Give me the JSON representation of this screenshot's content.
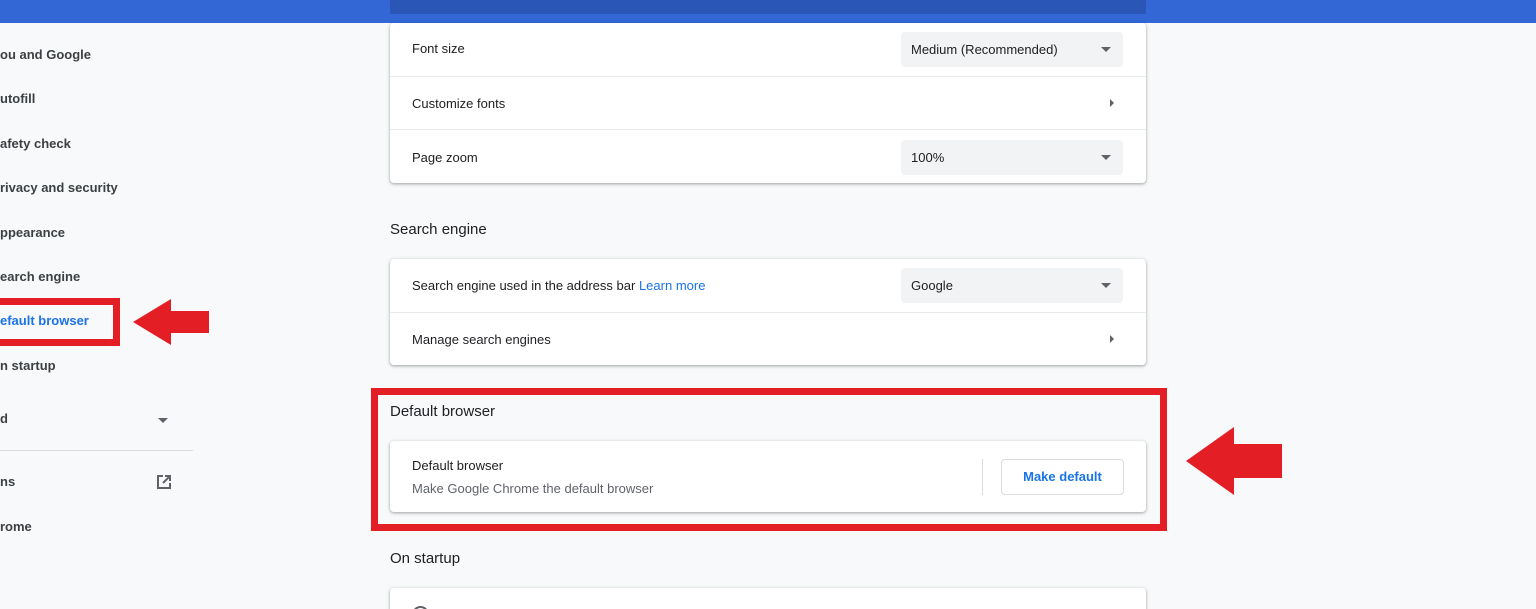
{
  "sidebar": {
    "items": [
      {
        "label": "ou and Google"
      },
      {
        "label": "utofill"
      },
      {
        "label": "afety check"
      },
      {
        "label": "rivacy and security"
      },
      {
        "label": "ppearance"
      },
      {
        "label": "earch engine"
      },
      {
        "label": "efault browser",
        "active": true
      },
      {
        "label": "n startup"
      },
      {
        "label": "d"
      },
      {
        "label": "ns"
      },
      {
        "label": "rome"
      }
    ]
  },
  "appearance_card": {
    "font_size": {
      "label": "Font size",
      "value": "Medium (Recommended)"
    },
    "customize_fonts": {
      "label": "Customize fonts"
    },
    "page_zoom": {
      "label": "Page zoom",
      "value": "100%"
    }
  },
  "search_engine": {
    "title": "Search engine",
    "used_label": "Search engine used in the address bar",
    "learn_more": "Learn more",
    "value": "Google",
    "manage_label": "Manage search engines"
  },
  "default_browser": {
    "title": "Default browser",
    "row_label": "Default browser",
    "row_sublabel": "Make Google Chrome the default browser",
    "button_label": "Make default"
  },
  "on_startup": {
    "title": "On startup"
  },
  "colors": {
    "topbar": "#3367d6",
    "accent": "#1a73e8",
    "annotation_red": "#e31e24"
  }
}
